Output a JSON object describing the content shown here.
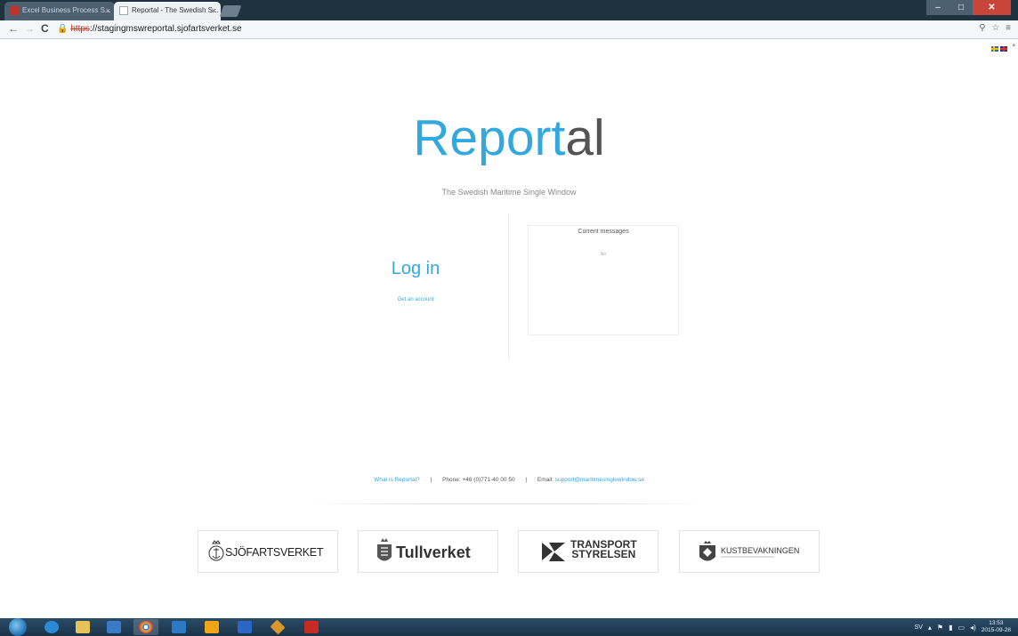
{
  "browser": {
    "tabs": [
      {
        "title": "Excel Business Process S..."
      },
      {
        "title": "Reportal - The Swedish S..."
      }
    ],
    "tab_close_glyph": "×",
    "window_buttons": {
      "minimize": "–",
      "maximize": "□",
      "close": "✕"
    },
    "url": {
      "scheme": "https",
      "rest": "://stagingmswreportal.sjofartsverket.se"
    },
    "icons": [
      "back-arrow-icon",
      "forward-arrow-icon",
      "reload-icon",
      "insecure-lock-icon",
      "zoom-icon",
      "star-icon",
      "menu-icon"
    ]
  },
  "page": {
    "language_flags": [
      "swedish-flag-icon",
      "uk-flag-icon"
    ],
    "logo": {
      "part1": "Report",
      "part2": "al"
    },
    "tagline": "The Swedish Maritime Single Window",
    "login": {
      "title": "Log in",
      "account_link": "Get an account"
    },
    "messages": {
      "title": "Current messages",
      "empty_text": "No"
    },
    "footer": {
      "about_link": "What is Reportal?",
      "separator": "|",
      "phone": "Phone: +46 (0)771-40 00 50",
      "email_label": "Email:",
      "email": "support@maritimesinglewindow.se"
    },
    "partners": [
      {
        "name": "SJÖFARTSVERKET"
      },
      {
        "name": "Tullverket"
      },
      {
        "name_line1": "TRANSPORT",
        "name_line2": "STYRELSEN"
      },
      {
        "name": "KUSTBEVAKNINGEN"
      }
    ],
    "colors": {
      "accent": "#33a8dd",
      "logo_gray": "#545454"
    }
  },
  "taskbar": {
    "apps": [
      "start-orb-icon",
      "internet-explorer-icon",
      "file-explorer-icon",
      "media-player-icon",
      "chrome-icon",
      "lync-icon",
      "outlook-icon",
      "word-icon",
      "app-icon",
      "acrobat-icon"
    ],
    "tray": {
      "language": "SV",
      "time": "13:53",
      "date": "2015-09-28"
    }
  }
}
